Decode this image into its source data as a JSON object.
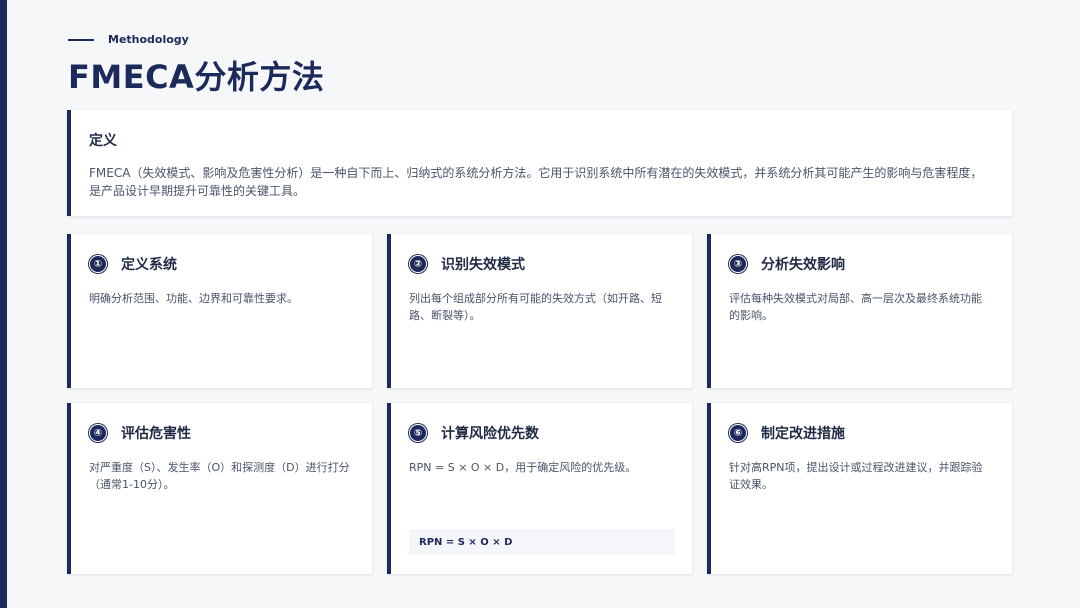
{
  "header": {
    "kicker": "Methodology",
    "title": "FMECA分析方法"
  },
  "definition": {
    "title": "定义",
    "body": "FMECA（失效模式、影响及危害性分析）是一种自下而上、归纳式的系统分析方法。它用于识别系统中所有潜在的失效模式，并系统分析其可能产生的影响与危害程度，是产品设计早期提升可靠性的关键工具。"
  },
  "steps": [
    {
      "num": "①",
      "title": "定义系统",
      "body": "明确分析范围、功能、边界和可靠性要求。"
    },
    {
      "num": "②",
      "title": "识别失效模式",
      "body": "列出每个组成部分所有可能的失效方式（如开路、短路、断裂等）。"
    },
    {
      "num": "③",
      "title": "分析失效影响",
      "body": "评估每种失效模式对局部、高一层次及最终系统功能的影响。"
    },
    {
      "num": "④",
      "title": "评估危害性",
      "body": "对严重度（S）、发生率（O）和探测度（D）进行打分（通常1-10分）。"
    },
    {
      "num": "⑤",
      "title": "计算风险优先数",
      "body": "RPN = S × O × D，用于确定风险的优先级。",
      "formula": "RPN = S × O × D"
    },
    {
      "num": "⑥",
      "title": "制定改进措施",
      "body": "针对高RPN项，提出设计或过程改进建议，并跟踪验证效果。"
    }
  ],
  "colors": {
    "accent": "#1b2a5a",
    "background": "#f6f7f9",
    "card": "#ffffff"
  }
}
